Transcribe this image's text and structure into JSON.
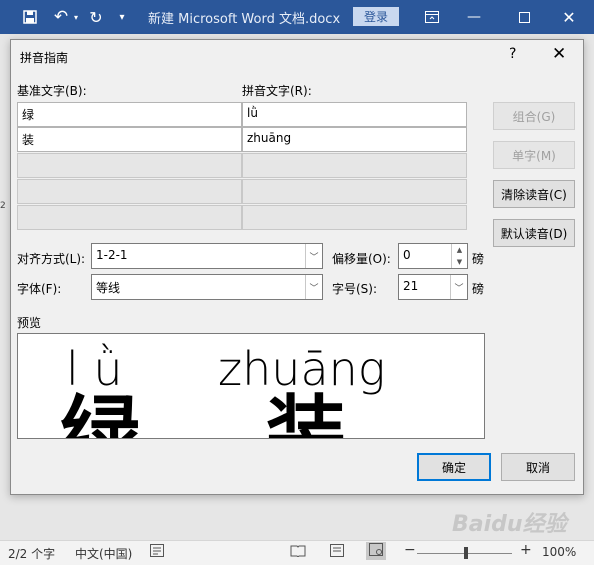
{
  "word": {
    "doc_title": "新建 Microsoft Word 文档.docx",
    "login_label": "登录",
    "ruler_number": "2",
    "status": {
      "page_info": "2/2 个字",
      "language": "中文(中国)",
      "zoom": "100%"
    }
  },
  "dialog": {
    "title": "拼音指南",
    "help": "?",
    "close": "✕",
    "base_header": "基准文字(B):",
    "ruby_header": "拼音文字(R):",
    "rows": [
      {
        "base": "绿",
        "ruby": "lǜ"
      },
      {
        "base": "装",
        "ruby": "zhuāng"
      }
    ],
    "buttons": {
      "group": "组合(G)",
      "single": "单字(M)",
      "clear": "清除读音(C)",
      "default": "默认读音(D)",
      "ok": "确定",
      "cancel": "取消"
    },
    "alignment_label": "对齐方式(L):",
    "alignment_value": "1-2-1",
    "offset_label": "偏移量(O):",
    "offset_value": "0",
    "offset_unit": "磅",
    "font_label": "字体(F):",
    "font_value": "等线",
    "size_label": "字号(S):",
    "size_value": "21",
    "size_unit": "磅",
    "preview_label": "预览",
    "preview": {
      "ruby1": "l ǜ",
      "ruby2": "zhuāng",
      "base1": "绿",
      "base2": "装"
    }
  },
  "watermark": "Baidu经验"
}
